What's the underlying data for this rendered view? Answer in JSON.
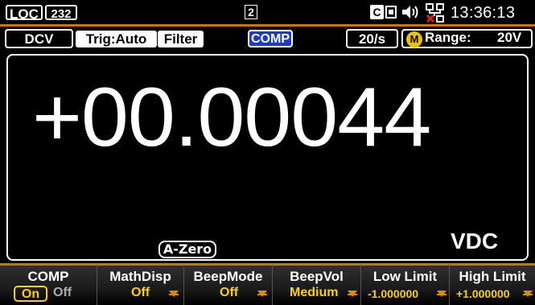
{
  "status_bar": {
    "loc": "LOC",
    "interface": "232",
    "page": "2",
    "lan_letter": "C",
    "clock": "13:36:13",
    "icons": [
      "lan-icon",
      "speaker-icon",
      "network-disconnected-icon"
    ]
  },
  "annunciators": {
    "function": "DCV",
    "trigger": "Trig:Auto",
    "filter": "Filter",
    "comp": "COMP",
    "rate": "20/s",
    "manual_badge": "M",
    "range_label": "Range:",
    "range_value": "20V"
  },
  "display": {
    "reading": "+00.00044",
    "unit": "VDC",
    "azero": "A-Zero"
  },
  "softkeys": [
    {
      "title": "COMP",
      "on": "On",
      "off": "Off"
    },
    {
      "title": "MathDisp",
      "value": "Off"
    },
    {
      "title": "BeepMode",
      "value": "Off"
    },
    {
      "title": "BeepVol",
      "value": "Medium"
    },
    {
      "title": "Low Limit",
      "value": "-1.000000"
    },
    {
      "title": "High Limit",
      "value": "+1.000000"
    }
  ],
  "colors": {
    "accent": "#c87a00",
    "value_yellow": "#ffd000",
    "comp_blue": "#1a3bd0",
    "manual_badge": "#f0c000"
  }
}
